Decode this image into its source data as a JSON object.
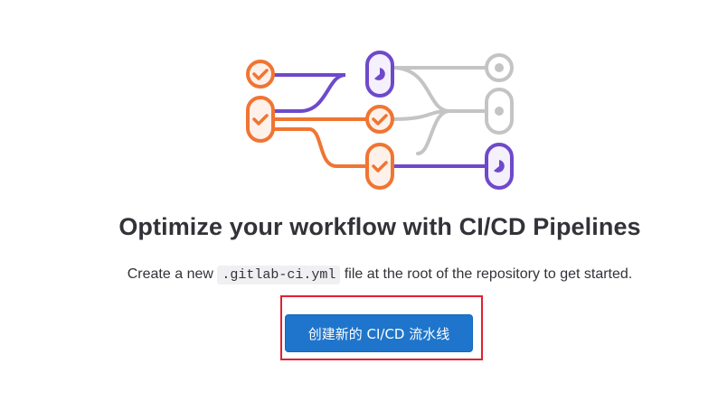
{
  "empty_state": {
    "title": "Optimize your workflow with CI/CD Pipelines",
    "description_before": "Create a new ",
    "description_code": ".gitlab-ci.yml",
    "description_after": " file at the root of the repository to get started.",
    "button_label": "创建新的 CI/CD 流水线"
  },
  "colors": {
    "orange": "#f07532",
    "purple": "#6e49cb",
    "gray": "#c4c4c4",
    "button": "#1f75cb",
    "highlight": "#e02030"
  },
  "icons": [
    "check-icon",
    "running-icon",
    "pending-icon"
  ]
}
